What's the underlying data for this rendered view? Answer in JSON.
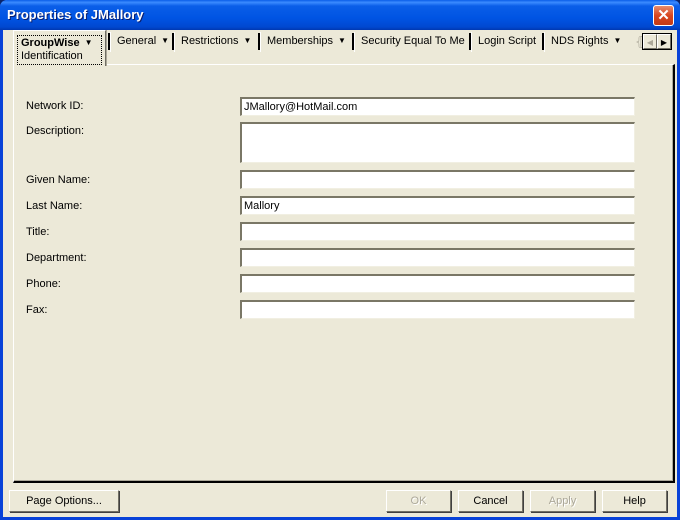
{
  "window": {
    "title": "Properties of JMallory",
    "close_icon": "close-x-icon"
  },
  "tabs": {
    "active": {
      "label": "GroupWise",
      "sub_label": "Identification",
      "has_dropdown": true
    },
    "items": [
      {
        "label": "General",
        "has_dropdown": true
      },
      {
        "label": "Restrictions",
        "has_dropdown": true
      },
      {
        "label": "Memberships",
        "has_dropdown": true
      },
      {
        "label": "Security Equal To Me",
        "has_dropdown": false
      },
      {
        "label": "Login Script",
        "has_dropdown": false
      },
      {
        "label": "NDS Rights",
        "has_dropdown": true
      }
    ],
    "dropdown_glyph": "▼",
    "scroll_left_glyph": "◀",
    "scroll_right_glyph": "▶",
    "scroll_left_enabled": false,
    "scroll_right_enabled": true
  },
  "form": {
    "fields": [
      {
        "label": "Network ID:",
        "value": "JMallory@HotMail.com",
        "multiline": false
      },
      {
        "label": "Description:",
        "value": "",
        "multiline": true
      },
      {
        "label": "Given Name:",
        "value": "",
        "multiline": false
      },
      {
        "label": "Last Name:",
        "value": "Mallory",
        "multiline": false
      },
      {
        "label": "Title:",
        "value": "",
        "multiline": false
      },
      {
        "label": "Department:",
        "value": "",
        "multiline": false
      },
      {
        "label": "Phone:",
        "value": "",
        "multiline": false
      },
      {
        "label": "Fax:",
        "value": "",
        "multiline": false
      }
    ]
  },
  "buttons": {
    "page_options": "Page Options...",
    "ok": "OK",
    "ok_enabled": false,
    "cancel": "Cancel",
    "apply": "Apply",
    "apply_enabled": false,
    "help": "Help"
  },
  "colors": {
    "titlebar": "#0054e3",
    "dialog_bg": "#ece9d8",
    "close_button": "#d9461f",
    "disabled_text": "#aca899"
  }
}
